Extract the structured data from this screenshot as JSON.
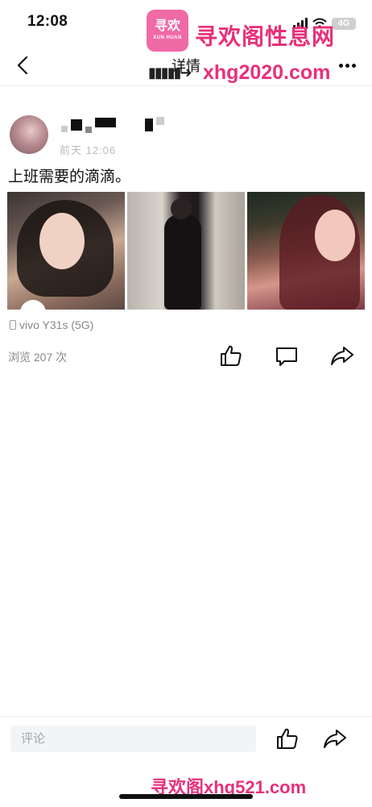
{
  "status_bar": {
    "time": "12:08",
    "network": "4G"
  },
  "watermark": {
    "logo_text": "寻欢",
    "logo_small": "XUN HUAN",
    "title": "寻欢阁性息网",
    "url_top": "xhg2020.com",
    "bottom_text": "寻欢阁xhg521.com"
  },
  "nav": {
    "title": "详情"
  },
  "post": {
    "time": "前天 12:06",
    "text": "上班需要的滴滴。",
    "device": "vivo Y31s (5G)",
    "views": "浏览 207 次"
  },
  "comment": {
    "placeholder": "评论"
  },
  "icons": {
    "back": "chevron-left-icon",
    "more": "more-dots-icon",
    "like": "thumbs-up-icon",
    "comment": "comment-bubble-icon",
    "share": "share-arrow-icon",
    "device": "phone-icon"
  },
  "colors": {
    "watermark": "#e8307a",
    "text_secondary": "#888888",
    "input_bg": "#f3f4f8"
  }
}
